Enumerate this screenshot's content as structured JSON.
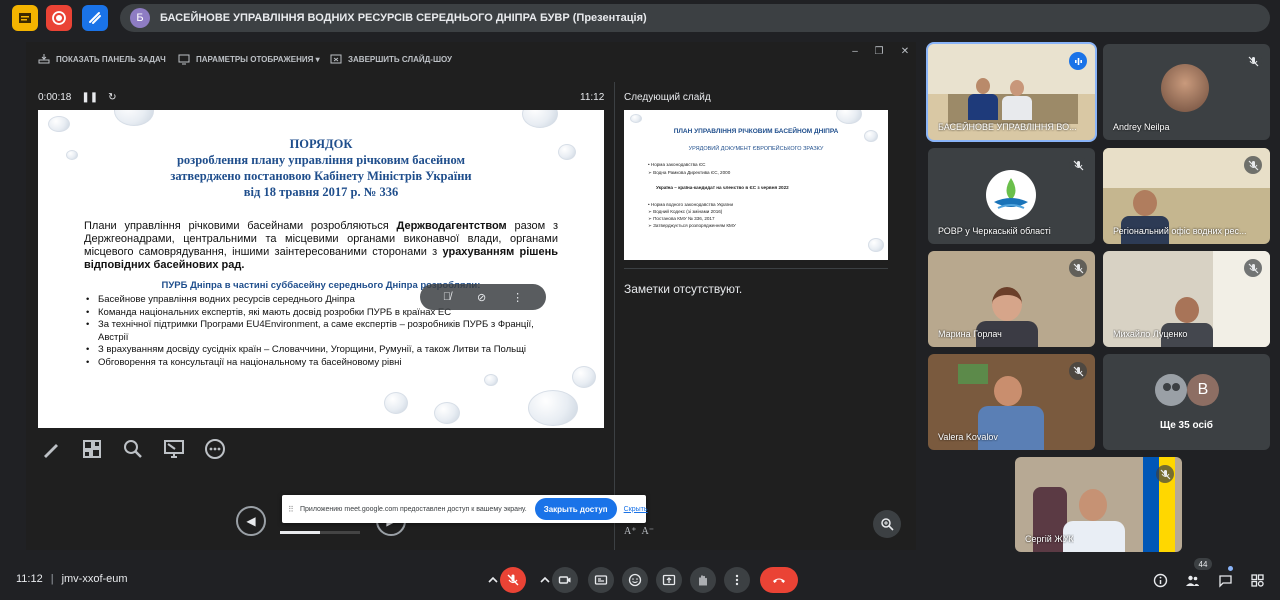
{
  "window": {
    "avatar_letter": "Б",
    "title": "БАСЕЙНОВЕ УПРАВЛІННЯ ВОДНИХ РЕСУРСІВ СЕРЕДНЬОГО ДНІПРА БУВР (Презентація)"
  },
  "presenter": {
    "toolbar": {
      "show_taskbar": "ПОКАЗАТЬ ПАНЕЛЬ ЗАДАЧ",
      "display_settings": "ПАРАМЕТРЫ ОТОБРАЖЕНИЯ ▾",
      "end_show": "ЗАВЕРШИТЬ СЛАЙД-ШОУ"
    },
    "elapsed": "0:00:18",
    "clock": "11:12",
    "next_slide_label": "Следующий слайд",
    "notes": "Заметки отсутствуют.",
    "progress_fraction": 0.5
  },
  "slide": {
    "title_lines": [
      "ПОРЯДОК",
      "розроблення плану управління річковим басейном",
      "затверджено постановою Кабінету Міністрів України",
      "від 18 травня 2017 р. № 336"
    ],
    "body_1": "Плани управління річковими басейнами розробляються ",
    "body_bold_1": "Держводагентством",
    "body_2": " разом з Держгеонадрами, центральними та місцевими органами виконавчої влади, органами місцевого самоврядування, іншими заінтересованими сторонами з ",
    "body_bold_2": "урахуванням рішень відповідних басейнових рад.",
    "subheading": "ПУРБ Дніпра в частині суббасейну середнього Дніпра розробляли:",
    "bullets": [
      "Басейнове управління водних ресурсів середнього Дніпра",
      "Команда національних експертів, які мають досвід розробки ПУРБ в країнах ЕС",
      "За технічної підтримки Програми EU4Environment, а саме експертів – розробників ПУРБ з Франції, Австрії",
      "З врахуванням досвіду сусідніх країн – Словаччини, Угорщини, Румунії, а також Литви та Польщі",
      "Обговорення та консультації на національному та басейновому рівні"
    ]
  },
  "next_slide": {
    "title": "ПЛАН УПРАВЛІННЯ РІЧКОВИМ БАСЕЙНОМ ДНІПРА",
    "subtitle": "УРЯДОВИЙ ДОКУМЕНТ ЄВРОПЕЙСЬКОГО ЗРАЗКУ",
    "lines": [
      "• Норма законодавства ЄС",
      "   ➢ Водна Рамкова Директива ЄС, 2000",
      "Україна – країна-кандидат на членство в ЄС з червня 2022",
      "• Норма водного законодавства України",
      "   ➢ Водний Кодекс (зі змінами 2016)",
      "   ➢ Постанова КМУ № 336, 2017",
      "   ➢ Затверджується розпорядженням КМУ"
    ]
  },
  "share_bar": {
    "message": "Приложению meet.google.com предоставлен доступ к вашему экрану.",
    "stop_label": "Закрыть доступ",
    "hide_label": "Скрыть"
  },
  "participants": [
    {
      "name": "БАСЕЙНОВЕ УПРАВЛІННЯ ВО...",
      "state": "speaking"
    },
    {
      "name": "Andrey Neilpa",
      "state": "muted"
    },
    {
      "name": "РОВР у Черкаській області",
      "state": "muted"
    },
    {
      "name": "Регіональний офіс водних рес...",
      "state": "muted"
    },
    {
      "name": "Марина Горлач",
      "state": "muted"
    },
    {
      "name": "Михайло Луценко",
      "state": "muted"
    },
    {
      "name": "Valera Kovalov",
      "state": "muted"
    },
    {
      "name": "Ще 35 осіб",
      "state": "others",
      "avatar_letter": "B"
    },
    {
      "name": "Сергій ЖУК",
      "state": "muted"
    }
  ],
  "bottom_bar": {
    "time": "11:12",
    "meeting_code": "jmv-xxof-eum",
    "participants_count": "44"
  },
  "colors": {
    "accent": "#1a73e8",
    "hangup": "#ea4335",
    "slide_title": "#1f4e8c",
    "background": "#202124"
  },
  "icons": [
    "slides-icon",
    "record-icon",
    "whiteboard-icon",
    "task-bar-icon",
    "display-settings-icon",
    "end-show-icon",
    "pause-icon",
    "restart-icon",
    "pen-icon",
    "grid-icon",
    "magnifier-icon",
    "screen-pointer-icon",
    "more-icon",
    "prev-icon",
    "next-icon",
    "zoom-icon",
    "mic-off-icon",
    "camera-icon",
    "captions-icon",
    "emoji-icon",
    "present-icon",
    "hand-icon",
    "more-options-icon",
    "hangup-icon",
    "info-icon",
    "people-icon",
    "activities-icon"
  ]
}
